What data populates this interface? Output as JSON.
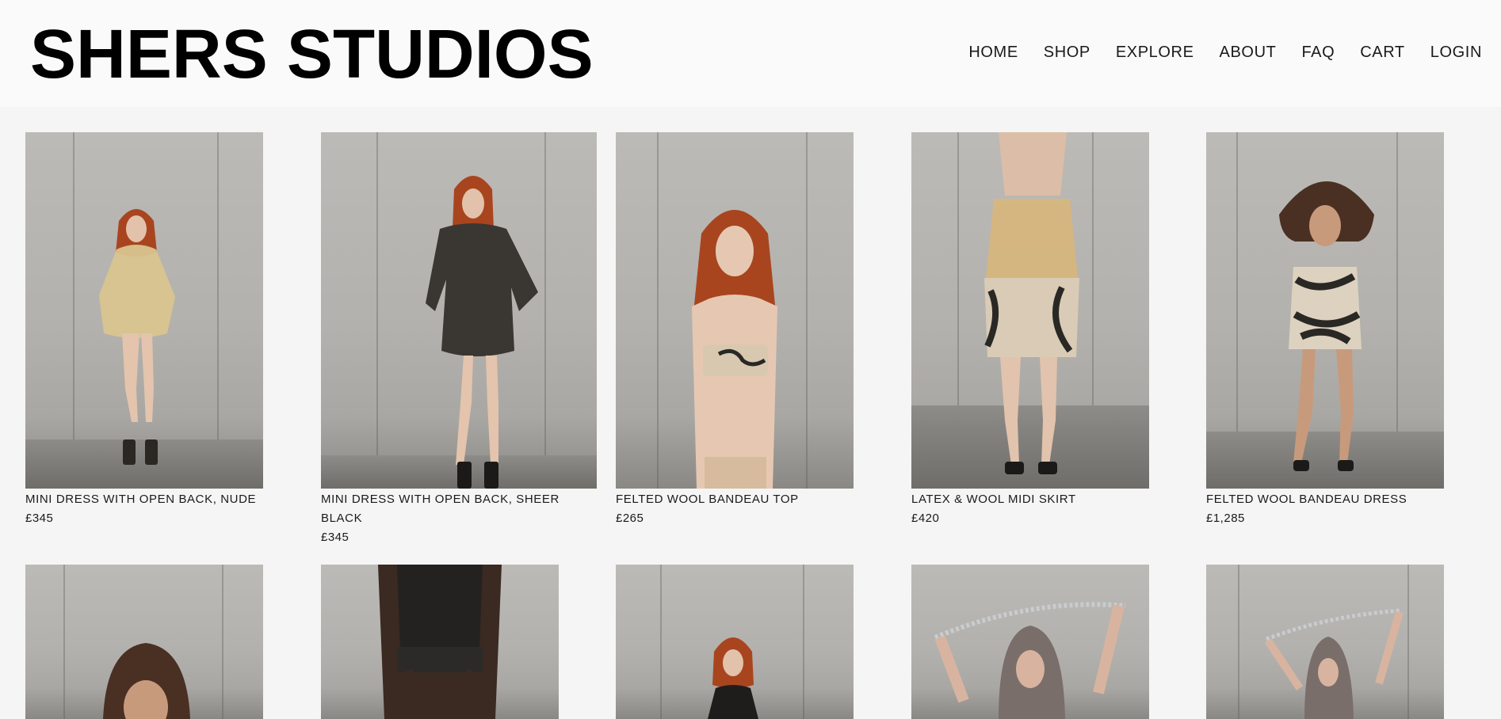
{
  "brand": {
    "name": "SHERS STUDIOS"
  },
  "nav": [
    {
      "label": "HOME"
    },
    {
      "label": "SHOP"
    },
    {
      "label": "EXPLORE"
    },
    {
      "label": "ABOUT"
    },
    {
      "label": "FAQ"
    },
    {
      "label": "CART"
    },
    {
      "label": "LOGIN"
    }
  ],
  "products": [
    {
      "name": "MINI DRESS WITH OPEN BACK, NUDE",
      "price": "£345",
      "image": "model-in-nude-latex-mini-dress"
    },
    {
      "name": "MINI DRESS WITH OPEN BACK, SHEER BLACK",
      "price": "£345",
      "image": "model-in-sheer-black-latex-mini-dress"
    },
    {
      "name": "FELTED WOOL BANDEAU TOP",
      "price": "£265",
      "image": "model-in-felted-wool-bandeau-top"
    },
    {
      "name": "LATEX & WOOL MIDI SKIRT",
      "price": "£420",
      "image": "model-in-latex-wool-midi-skirt"
    },
    {
      "name": "FELTED WOOL BANDEAU DRESS",
      "price": "£1,285",
      "image": "model-in-felted-wool-bandeau-dress"
    },
    {
      "image": "model-with-curly-hair"
    },
    {
      "image": "model-in-knit-mini-skirt"
    },
    {
      "image": "model-in-black-top"
    },
    {
      "image": "model-in-latex-hood-with-chain"
    },
    {
      "image": "model-in-latex-hood-with-chain-2"
    }
  ]
}
